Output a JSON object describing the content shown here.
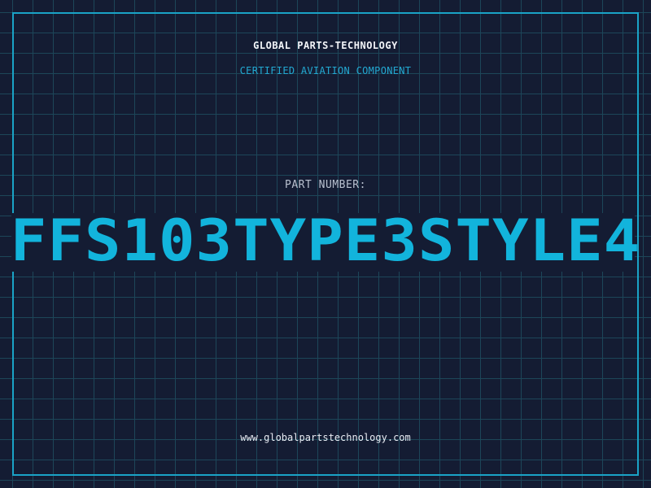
{
  "header": {
    "company": "GLOBAL PARTS-TECHNOLOGY",
    "subtitle": "CERTIFIED AVIATION COMPONENT"
  },
  "part": {
    "label": "PART NUMBER:",
    "number": "FFS103TYPE3STYLE4"
  },
  "footer": {
    "website": "www.globalpartstechnology.com"
  },
  "colors": {
    "background": "#141c33",
    "grid": "#1d4659",
    "accent": "#12b4dc",
    "frame": "#1aa3c6"
  }
}
